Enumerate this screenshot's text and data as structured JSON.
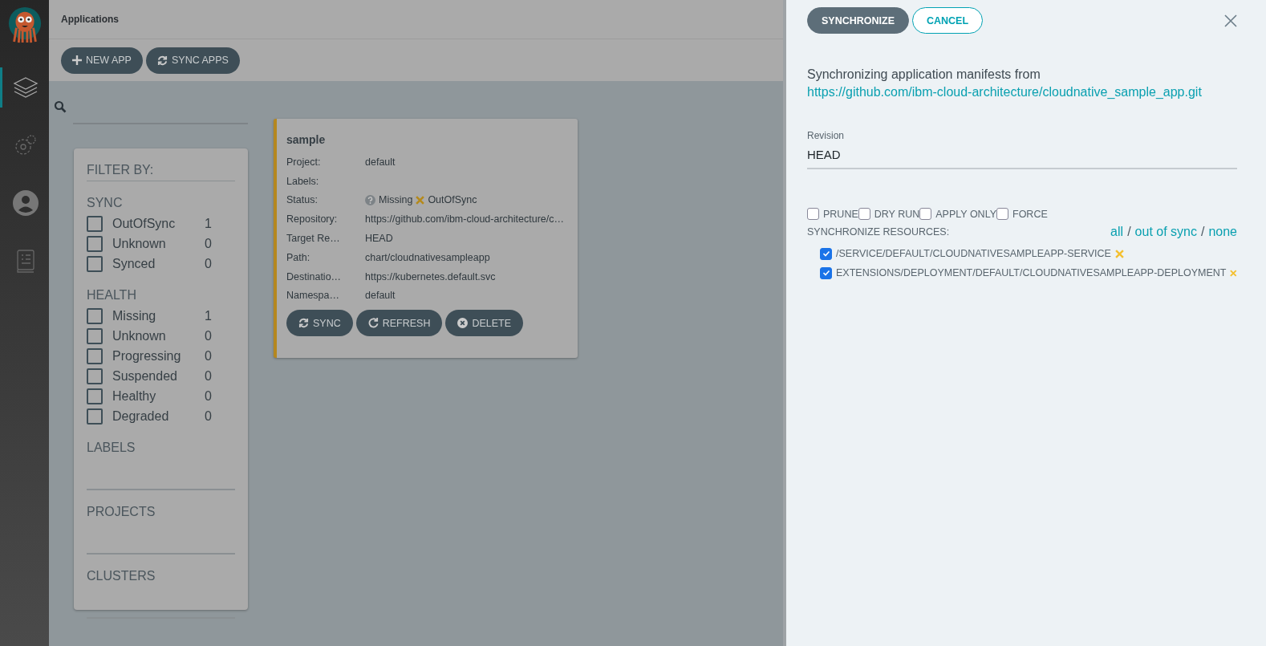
{
  "nav_items": [
    {
      "kind": "applications",
      "selected": true
    },
    {
      "kind": "settings",
      "selected": false
    },
    {
      "kind": "user",
      "selected": false
    },
    {
      "kind": "docs",
      "selected": false
    }
  ],
  "header": {
    "title": "Applications"
  },
  "toolbar": [
    {
      "kind": "plus",
      "label": "NEW APP"
    },
    {
      "kind": "sync",
      "label": "SYNC APPS"
    }
  ],
  "filter": {
    "title": "FILTER BY:",
    "groups": [
      {
        "title": "SYNC",
        "items": [
          {
            "label": "OutOfSync",
            "count": "1",
            "checked": false
          },
          {
            "label": "Unknown",
            "count": "0",
            "checked": false
          },
          {
            "label": "Synced",
            "count": "0",
            "checked": false
          }
        ]
      },
      {
        "title": "HEALTH",
        "items": [
          {
            "label": "Missing",
            "count": "1",
            "checked": false
          },
          {
            "label": "Unknown",
            "count": "0",
            "checked": false
          },
          {
            "label": "Progressing",
            "count": "0",
            "checked": false
          },
          {
            "label": "Suspended",
            "count": "0",
            "checked": false
          },
          {
            "label": "Healthy",
            "count": "0",
            "checked": false
          },
          {
            "label": "Degraded",
            "count": "0",
            "checked": false
          }
        ]
      },
      {
        "title": "LABELS",
        "kind": "input"
      },
      {
        "title": "PROJECTS",
        "kind": "input"
      },
      {
        "title": "CLUSTERS",
        "kind": "input"
      }
    ]
  },
  "app_card": {
    "name": "sample",
    "fields": [
      {
        "kind": "text",
        "label": "Project:",
        "value": "default"
      },
      {
        "kind": "text",
        "label": "Labels:"
      },
      {
        "kind": "status",
        "label": "Status:",
        "health": "Missing",
        "sync": "OutOfSync"
      },
      {
        "kind": "text",
        "label": "Repository:",
        "value": "https://github.com/ibm-cloud-architecture/c…"
      },
      {
        "kind": "text",
        "label": "Target Re…",
        "value": "HEAD"
      },
      {
        "kind": "text",
        "label": "Path:",
        "value": "chart/cloudnativesampleapp"
      },
      {
        "kind": "text",
        "label": "Destinatio…",
        "value": "https://kubernetes.default.svc"
      },
      {
        "kind": "text",
        "label": "Namespa…",
        "value": "default"
      }
    ],
    "buttons": [
      {
        "kind": "sync",
        "label": "SYNC"
      },
      {
        "kind": "refresh",
        "label": "REFRESH"
      },
      {
        "kind": "delete",
        "label": "DELETE"
      }
    ]
  },
  "panel": {
    "primary": "SYNCHRONIZE",
    "cancel": "CANCEL",
    "message": "Synchronizing application manifests from",
    "repo_link": "https://github.com/ibm-cloud-architecture/cloudnative_sample_app.git",
    "revision": {
      "label": "Revision",
      "value": "HEAD"
    },
    "options": [
      {
        "label": "PRUNE",
        "checked": false
      },
      {
        "label": "DRY RUN",
        "checked": false
      },
      {
        "label": "APPLY ONLY",
        "checked": false
      },
      {
        "label": "FORCE",
        "checked": false
      }
    ],
    "resources_title": "SYNCHRONIZE RESOURCES:",
    "select_links": [
      "all",
      "out of sync",
      "none"
    ],
    "select_separator": "/",
    "resources": [
      {
        "name": "/SERVICE/DEFAULT/CLOUDNATIVESAMPLEAPP-SERVICE",
        "checked": true
      },
      {
        "name": "EXTENSIONS/DEPLOYMENT/DEFAULT/CLOUDNATIVESAMPLEAPP-DEPLOYMENT",
        "checked": true
      }
    ]
  }
}
